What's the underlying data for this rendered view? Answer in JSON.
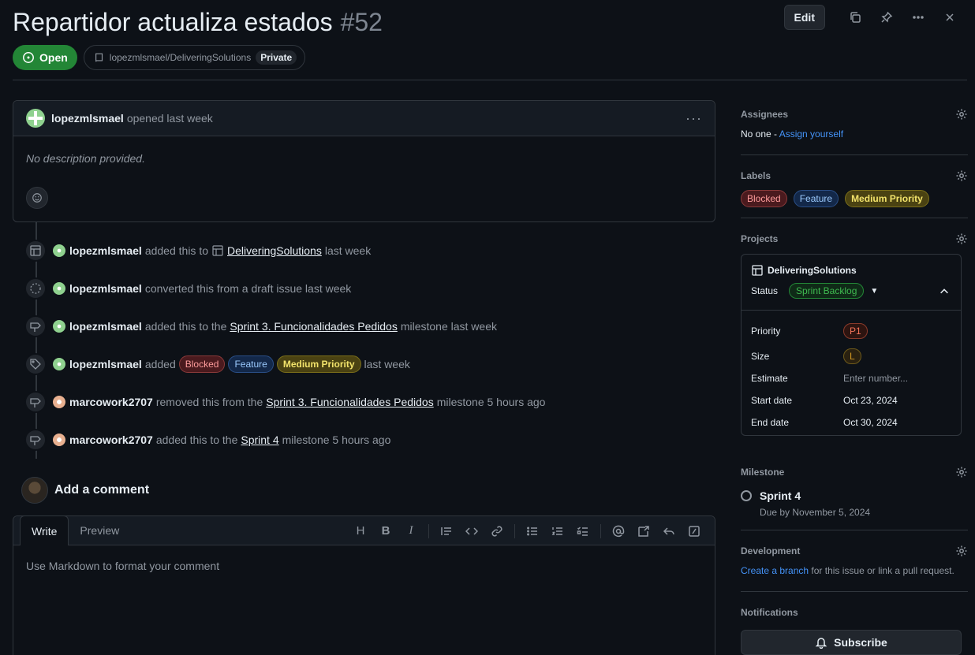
{
  "issue": {
    "title": "Repartidor actualiza estados",
    "number": "#52",
    "state": "Open",
    "repo": "lopezmlsmael/DeliveringSolutions",
    "visibility": "Private"
  },
  "header": {
    "edit_label": "Edit"
  },
  "comment": {
    "author": "lopezmlsmael",
    "action": "opened last week",
    "body": "No description provided."
  },
  "timeline": [
    {
      "author": "lopezmlsmael",
      "icon": "table-icon",
      "avatar": "green",
      "pre": "added this to",
      "link": "DeliveringSolutions",
      "post": "last week"
    },
    {
      "author": "lopezmlsmael",
      "icon": "draft-icon",
      "avatar": "green",
      "pre": "converted this from a draft issue last week"
    },
    {
      "author": "lopezmlsmael",
      "icon": "milestone-icon",
      "avatar": "green",
      "pre": "added this to the",
      "link": "Sprint 3. Funcionalidades Pedidos",
      "post": "milestone last week"
    },
    {
      "author": "lopezmlsmael",
      "icon": "tag-icon",
      "avatar": "green",
      "pre": "added",
      "labels": [
        "Blocked",
        "Feature",
        "Medium Priority"
      ],
      "post": "last week"
    },
    {
      "author": "marcowork2707",
      "icon": "milestone-icon",
      "avatar": "peach",
      "pre": "removed this from the",
      "link": "Sprint 3. Funcionalidades Pedidos",
      "post": "milestone 5 hours ago"
    },
    {
      "author": "marcowork2707",
      "icon": "milestone-icon",
      "avatar": "peach",
      "pre": "added this to the",
      "link": "Sprint 4",
      "post": "milestone 5 hours ago"
    }
  ],
  "composer": {
    "title": "Add a comment",
    "tab_write": "Write",
    "tab_preview": "Preview",
    "placeholder": "Use Markdown to format your comment",
    "heading_label": "H",
    "bold_label": "B",
    "italic_label": "I"
  },
  "sidebar": {
    "assignees": {
      "title": "Assignees",
      "none": "No one - ",
      "assign": "Assign yourself"
    },
    "labels": {
      "title": "Labels",
      "items": [
        "Blocked",
        "Feature",
        "Medium Priority"
      ]
    },
    "projects": {
      "title": "Projects",
      "name": "DeliveringSolutions",
      "status_label": "Status",
      "status_value": "Sprint Backlog",
      "fields": {
        "priority_label": "Priority",
        "priority_value": "P1",
        "size_label": "Size",
        "size_value": "L",
        "estimate_label": "Estimate",
        "estimate_placeholder": "Enter number...",
        "start_label": "Start date",
        "start_value": "Oct 23, 2024",
        "end_label": "End date",
        "end_value": "Oct 30, 2024"
      }
    },
    "milestone": {
      "title": "Milestone",
      "name": "Sprint 4",
      "due": "Due by November 5, 2024"
    },
    "development": {
      "title": "Development",
      "link": "Create a branch",
      "text": " for this issue or link a pull request."
    },
    "notifications": {
      "title": "Notifications",
      "subscribe": "Subscribe"
    }
  },
  "colors": {
    "background": "#0d1117",
    "open_green": "#238636",
    "link_blue": "#4493f8",
    "border": "#30363d"
  }
}
